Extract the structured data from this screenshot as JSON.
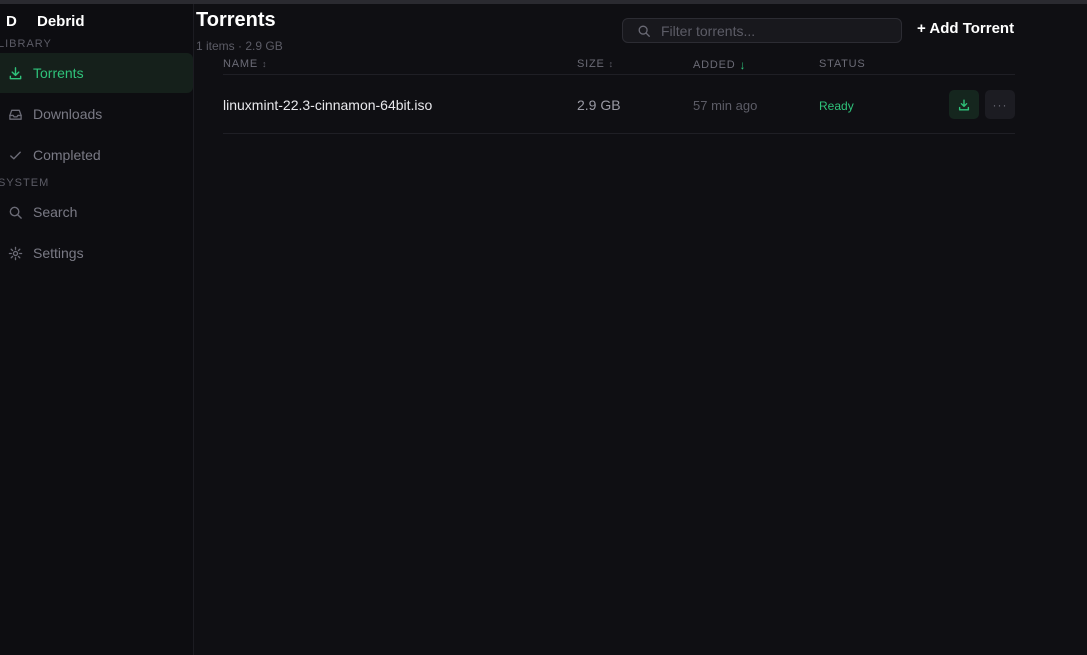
{
  "brand": {
    "logo": "D",
    "name": "Debrid"
  },
  "sidebar": {
    "sections": [
      {
        "label": "LIBRARY"
      },
      {
        "label": "SYSTEM"
      }
    ],
    "items": [
      {
        "label": "Torrents",
        "icon": "download-icon",
        "active": true
      },
      {
        "label": "Downloads",
        "icon": "inbox-icon",
        "active": false
      },
      {
        "label": "Completed",
        "icon": "check-icon",
        "active": false
      },
      {
        "label": "Search",
        "icon": "search-icon",
        "active": false
      },
      {
        "label": "Settings",
        "icon": "gear-icon",
        "active": false
      }
    ]
  },
  "header": {
    "title": "Torrents",
    "subtitle": "1 items · 2.9 GB",
    "search_placeholder": "Filter torrents...",
    "add_label": "+ Add Torrent"
  },
  "table": {
    "columns": [
      {
        "label": "NAME",
        "sort": "↕"
      },
      {
        "label": "SIZE",
        "sort": "↕"
      },
      {
        "label": "ADDED",
        "sort": "↓"
      },
      {
        "label": "STATUS",
        "sort": ""
      }
    ],
    "rows": [
      {
        "name": "linuxmint-22.3-cinnamon-64bit.iso",
        "size": "2.9 GB",
        "added": "57 min ago",
        "status": "Ready",
        "more_label": "···"
      }
    ]
  },
  "colors": {
    "accent": "#2fc27a",
    "background": "#0f0f13",
    "sidebar": "#0d0d11"
  }
}
